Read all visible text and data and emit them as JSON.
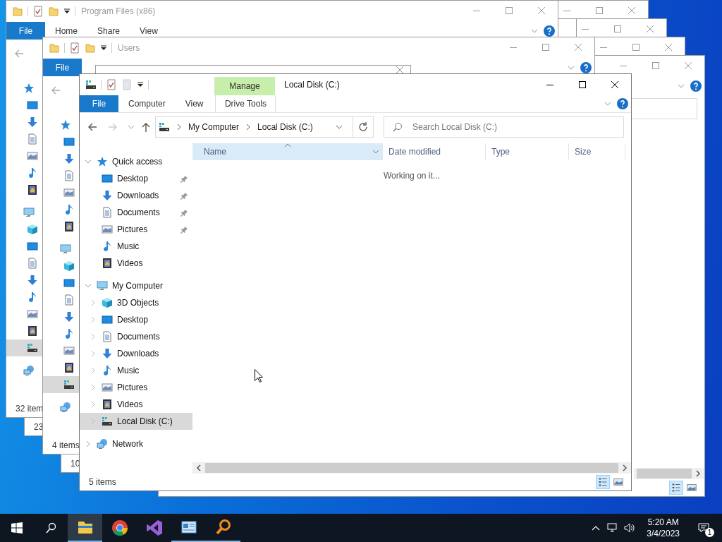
{
  "desktop": {
    "windows": [
      {
        "kind": "explorer",
        "quick_access_toolbar": [
          {
            "kind": "folder"
          },
          {
            "kind": "properties"
          },
          {
            "kind": "new-folder"
          },
          {
            "kind": "customize"
          }
        ],
        "title": "Program Files (x86)",
        "tabs": [
          {
            "label": "File",
            "kind": "file"
          },
          {
            "label": "Home",
            "kind": "tab"
          },
          {
            "label": "Share",
            "kind": "tab"
          },
          {
            "label": "View",
            "kind": "tab"
          }
        ],
        "navigation_pane": [
          {
            "kind": "quick-access",
            "selected": false,
            "children": [
              {
                "kind": "desktop",
                "selected": false
              },
              {
                "kind": "downloads",
                "selected": false
              },
              {
                "kind": "documents",
                "selected": false
              },
              {
                "kind": "pictures",
                "selected": false
              },
              {
                "kind": "music",
                "selected": false
              },
              {
                "kind": "videos",
                "selected": false
              }
            ]
          },
          {
            "kind": "computer",
            "selected": false,
            "children": [
              {
                "kind": "objects3d",
                "selected": false
              },
              {
                "kind": "desktop",
                "selected": false
              },
              {
                "kind": "documents",
                "selected": false
              },
              {
                "kind": "downloads",
                "selected": false
              },
              {
                "kind": "music",
                "selected": false
              },
              {
                "kind": "pictures",
                "selected": false
              },
              {
                "kind": "videos",
                "selected": false
              },
              {
                "kind": "disk",
                "selected": true
              }
            ]
          },
          {
            "kind": "network",
            "selected": false
          }
        ],
        "status": "32 item"
      },
      {
        "kind": "frame"
      },
      {
        "kind": "explorer",
        "status": "23"
      },
      {
        "kind": "frame"
      },
      {
        "kind": "explorer",
        "quick_access_toolbar": [
          {
            "kind": "folder"
          },
          {
            "kind": "properties"
          },
          {
            "kind": "new-folder"
          },
          {
            "kind": "customize"
          }
        ],
        "title": "Users",
        "tabs": [
          {
            "label": "File",
            "kind": "file"
          }
        ],
        "navigation_pane": [
          {
            "kind": "quick-access",
            "selected": false,
            "children": [
              {
                "kind": "desktop",
                "selected": false
              },
              {
                "kind": "downloads",
                "selected": false
              },
              {
                "kind": "documents",
                "selected": false
              },
              {
                "kind": "pictures",
                "selected": false
              },
              {
                "kind": "music",
                "selected": false
              },
              {
                "kind": "videos",
                "selected": false
              }
            ]
          },
          {
            "kind": "computer",
            "selected": false,
            "children": [
              {
                "kind": "objects3d",
                "selected": false
              },
              {
                "kind": "desktop",
                "selected": false
              },
              {
                "kind": "documents",
                "selected": false
              },
              {
                "kind": "downloads",
                "selected": false
              },
              {
                "kind": "music",
                "selected": false
              },
              {
                "kind": "pictures",
                "selected": false
              },
              {
                "kind": "videos",
                "selected": false
              },
              {
                "kind": "disk",
                "selected": true
              }
            ]
          },
          {
            "kind": "network",
            "selected": false
          }
        ],
        "status": "4 items"
      },
      {
        "kind": "frame"
      },
      {
        "kind": "explorer",
        "status": "10"
      },
      {
        "kind": "explorer",
        "view_modes": [
          {
            "kind": "details",
            "selected": true
          },
          {
            "kind": "large-icons",
            "selected": false
          }
        ]
      },
      {
        "kind": "dialog"
      }
    ],
    "active_window": {
      "quick_access_toolbar": [
        {
          "kind": "disk"
        },
        {
          "kind": "properties"
        },
        {
          "kind": "blank"
        },
        {
          "kind": "customize"
        }
      ],
      "contextual_tab": "Manage",
      "title": "Local Disk (C:)",
      "tabs": [
        {
          "label": "File",
          "kind": "file"
        },
        {
          "label": "Computer",
          "kind": "tab"
        },
        {
          "label": "View",
          "kind": "tab"
        },
        {
          "label": "Drive Tools",
          "kind": "contextual"
        }
      ],
      "address_bar": {
        "segments": [
          "My Computer",
          "Local Disk (C:)"
        ]
      },
      "search": {
        "placeholder": "Search Local Disk (C:)"
      },
      "navigation_pane": [
        {
          "label": "Quick access",
          "kind": "quick-access",
          "expanded": true,
          "selected": false,
          "children": [
            {
              "label": "Desktop",
              "kind": "desktop",
              "pinned": true,
              "selected": false
            },
            {
              "label": "Downloads",
              "kind": "downloads",
              "pinned": true,
              "selected": false
            },
            {
              "label": "Documents",
              "kind": "documents",
              "pinned": true,
              "selected": false
            },
            {
              "label": "Pictures",
              "kind": "pictures",
              "pinned": true,
              "selected": false
            },
            {
              "label": "Music",
              "kind": "music",
              "pinned": false,
              "selected": false
            },
            {
              "label": "Videos",
              "kind": "videos",
              "pinned": false,
              "selected": false
            }
          ]
        },
        {
          "label": "My Computer",
          "kind": "computer",
          "expanded": true,
          "selected": false,
          "children": [
            {
              "label": "3D Objects",
              "kind": "objects3d",
              "expandable": true,
              "selected": false
            },
            {
              "label": "Desktop",
              "kind": "desktop",
              "expandable": true,
              "selected": false
            },
            {
              "label": "Documents",
              "kind": "documents",
              "expandable": true,
              "selected": false
            },
            {
              "label": "Downloads",
              "kind": "downloads",
              "expandable": true,
              "selected": false
            },
            {
              "label": "Music",
              "kind": "music",
              "expandable": true,
              "selected": false
            },
            {
              "label": "Pictures",
              "kind": "pictures",
              "expandable": true,
              "selected": false
            },
            {
              "label": "Videos",
              "kind": "videos",
              "expandable": true,
              "selected": false
            },
            {
              "label": "Local Disk (C:)",
              "kind": "disk",
              "expandable": true,
              "selected": true
            }
          ]
        },
        {
          "label": "Network",
          "kind": "network",
          "expanded": false,
          "selected": false
        }
      ],
      "columns": [
        {
          "label": "Name",
          "highlighted": true,
          "sorted": true
        },
        {
          "label": "Date modified",
          "highlighted": false,
          "sorted": false
        },
        {
          "label": "Type",
          "highlighted": false,
          "sorted": false
        },
        {
          "label": "Size",
          "highlighted": false,
          "sorted": false
        }
      ],
      "message": "Working on it...",
      "status": "5 items",
      "view_modes": [
        {
          "kind": "details",
          "selected": true
        },
        {
          "kind": "large-icons",
          "selected": false
        }
      ]
    }
  },
  "taskbar": {
    "apps": [
      {
        "kind": "file-explorer",
        "running": true,
        "active": true
      },
      {
        "kind": "browser",
        "running": false,
        "active": false
      },
      {
        "kind": "studio",
        "running": false,
        "active": false
      },
      {
        "kind": "app-window",
        "running": true,
        "active": false
      },
      {
        "kind": "magnifier",
        "running": true,
        "active": false
      }
    ],
    "clock": {
      "time": "5:20 AM",
      "date": "3/4/2023"
    },
    "notifications": "1"
  }
}
